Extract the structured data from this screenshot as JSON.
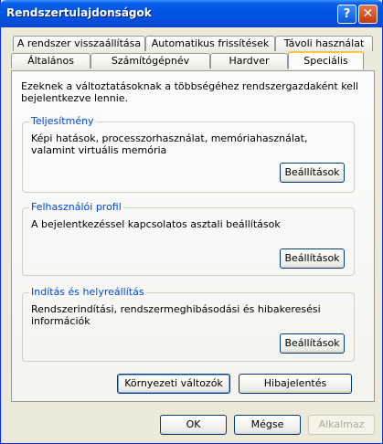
{
  "window": {
    "title": "Rendszertulajdonságok",
    "help_label": "?",
    "close_label": "✕"
  },
  "tabs": {
    "row_back": [
      "A rendszer visszaállítása",
      "Automatikus frissítések",
      "Távoli használat"
    ],
    "row_front": [
      "Általános",
      "Számítógépnév",
      "Hardver",
      "Speciális"
    ],
    "active": "Speciális"
  },
  "intro": "Ezeknek a változtatásoknak a többségéhez rendszergazdaként kell bejelentkezve lennie.",
  "groups": {
    "performance": {
      "label": "Teljesítmény",
      "text": "Képi hatások, processzorhasználat, memóriahasználat, valamint virtuális memória",
      "button": "Beállítások"
    },
    "profile": {
      "label": "Felhasználói profil",
      "text": "A bejelentkezéssel kapcsolatos asztali beállítások",
      "button": "Beállítások"
    },
    "startup": {
      "label": "Indítás és helyreállítás",
      "text": "Rendszerindítási, rendszermeghibásodási és hibakeresési információk",
      "button": "Beállítások"
    }
  },
  "buttons": {
    "env": "Környezeti változók",
    "error_report": "Hibajelentés",
    "ok": "OK",
    "cancel": "Mégse",
    "apply": "Alkalmaz"
  }
}
